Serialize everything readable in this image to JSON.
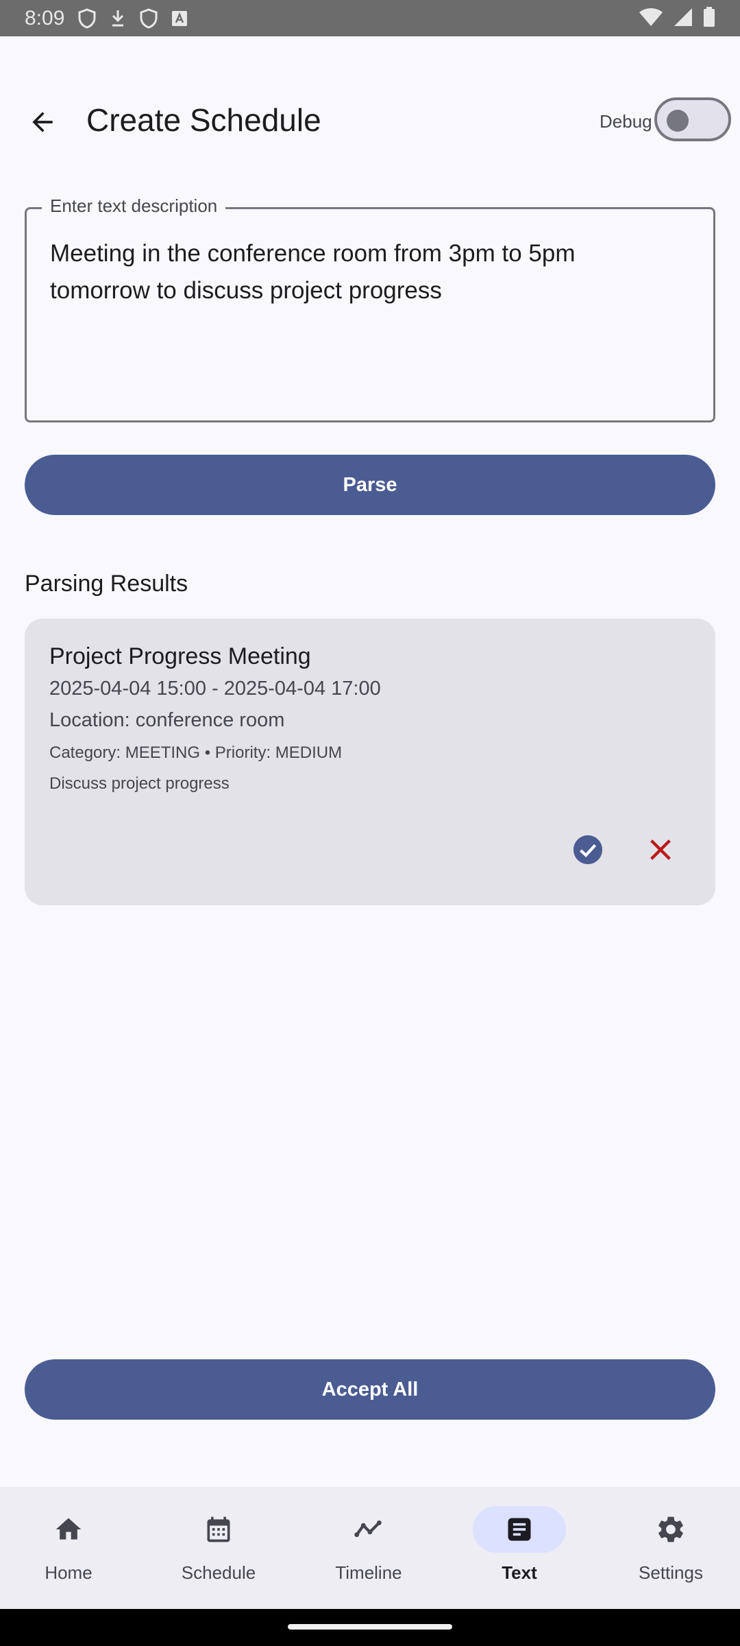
{
  "status_bar": {
    "time": "8:09"
  },
  "app_bar": {
    "title": "Create Schedule",
    "debug_label": "Debug",
    "debug_enabled": false
  },
  "input": {
    "label": "Enter text description",
    "value": "Meeting in the conference room from 3pm to 5pm tomorrow to discuss project progress"
  },
  "parse_button": "Parse",
  "results": {
    "heading": "Parsing Results",
    "items": [
      {
        "title": "Project Progress Meeting",
        "time_range": "2025-04-04 15:00 - 2025-04-04 17:00",
        "location": "Location: conference room",
        "meta": "Category: MEETING • Priority: MEDIUM",
        "description": "Discuss project progress"
      }
    ]
  },
  "accept_all_button": "Accept All",
  "bottom_nav": {
    "active": "Text",
    "items": [
      {
        "label": "Home",
        "icon": "home-icon"
      },
      {
        "label": "Schedule",
        "icon": "calendar-icon"
      },
      {
        "label": "Timeline",
        "icon": "timeline-icon"
      },
      {
        "label": "Text",
        "icon": "article-icon"
      },
      {
        "label": "Settings",
        "icon": "gear-icon"
      }
    ]
  },
  "colors": {
    "primary": "#4a5c92",
    "reject": "#ba1a1a",
    "background": "#f8f8fd",
    "card": "#e3e2e8",
    "nav_active_indicator": "#dbe1ff"
  }
}
